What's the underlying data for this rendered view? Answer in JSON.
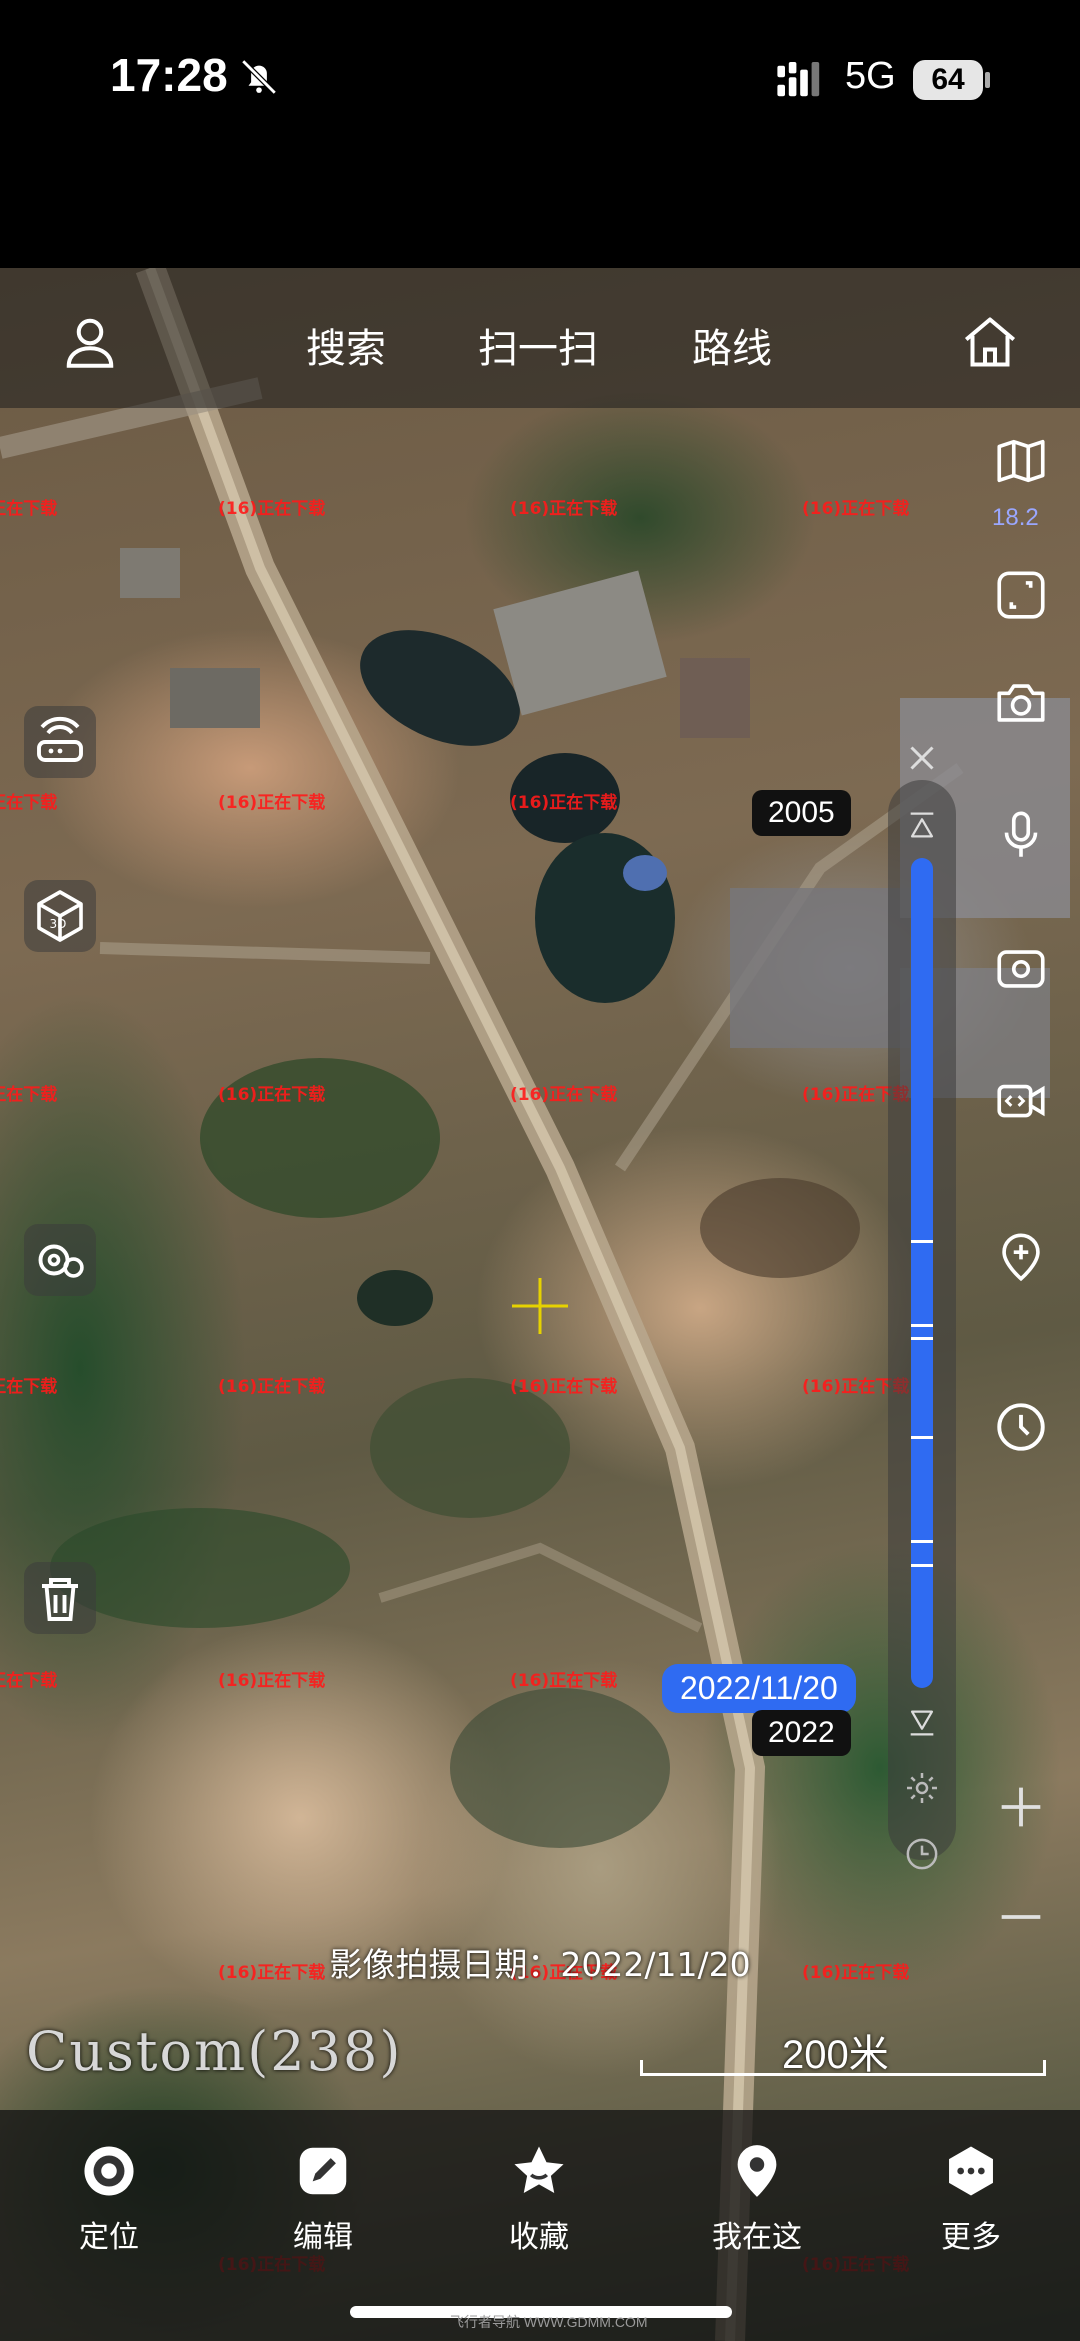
{
  "status_bar": {
    "time": "17:28",
    "network": "5G",
    "battery": "64",
    "icons": [
      "bell-off-icon",
      "signal-icon",
      "battery-icon"
    ]
  },
  "top_bar": {
    "links": [
      "搜索",
      "扫一扫",
      "路线"
    ],
    "icons": [
      "user-icon",
      "home-icon"
    ]
  },
  "right_tools": {
    "zoom_level": "18.2",
    "icons": [
      "map-layers-icon",
      "fullscreen-icon",
      "camera-icon",
      "microphone-icon",
      "rotate-camera-icon",
      "video-icon",
      "add-marker-icon",
      "history-clock-icon",
      "zoom-in-icon",
      "zoom-out-icon"
    ]
  },
  "left_tools": {
    "icons": [
      "router-icon",
      "3d-cube-icon",
      "settings-group-icon",
      "trash-icon"
    ]
  },
  "time_slider": {
    "start_year": "2005",
    "end_year": "2022",
    "selected_date": "2022/11/20",
    "position": 1.0
  },
  "map": {
    "watermark": "(16)正在下载",
    "imagery_caption": "影像拍摄日期：2022/11/20",
    "source_label": "Custom(238)",
    "scale_text": "200米"
  },
  "bottom_nav": {
    "items": [
      {
        "label": "定位",
        "icon": "locate-icon"
      },
      {
        "label": "编辑",
        "icon": "edit-icon"
      },
      {
        "label": "收藏",
        "icon": "star-icon"
      },
      {
        "label": "我在这",
        "icon": "location-pin-icon"
      },
      {
        "label": "更多",
        "icon": "more-icon"
      }
    ]
  },
  "footer_mark": "飞行者导航 WWW.GDMM.COM",
  "colors": {
    "accent": "#2f6bf2",
    "watermark": "#ff1a1a",
    "crosshair": "#e6d200"
  }
}
